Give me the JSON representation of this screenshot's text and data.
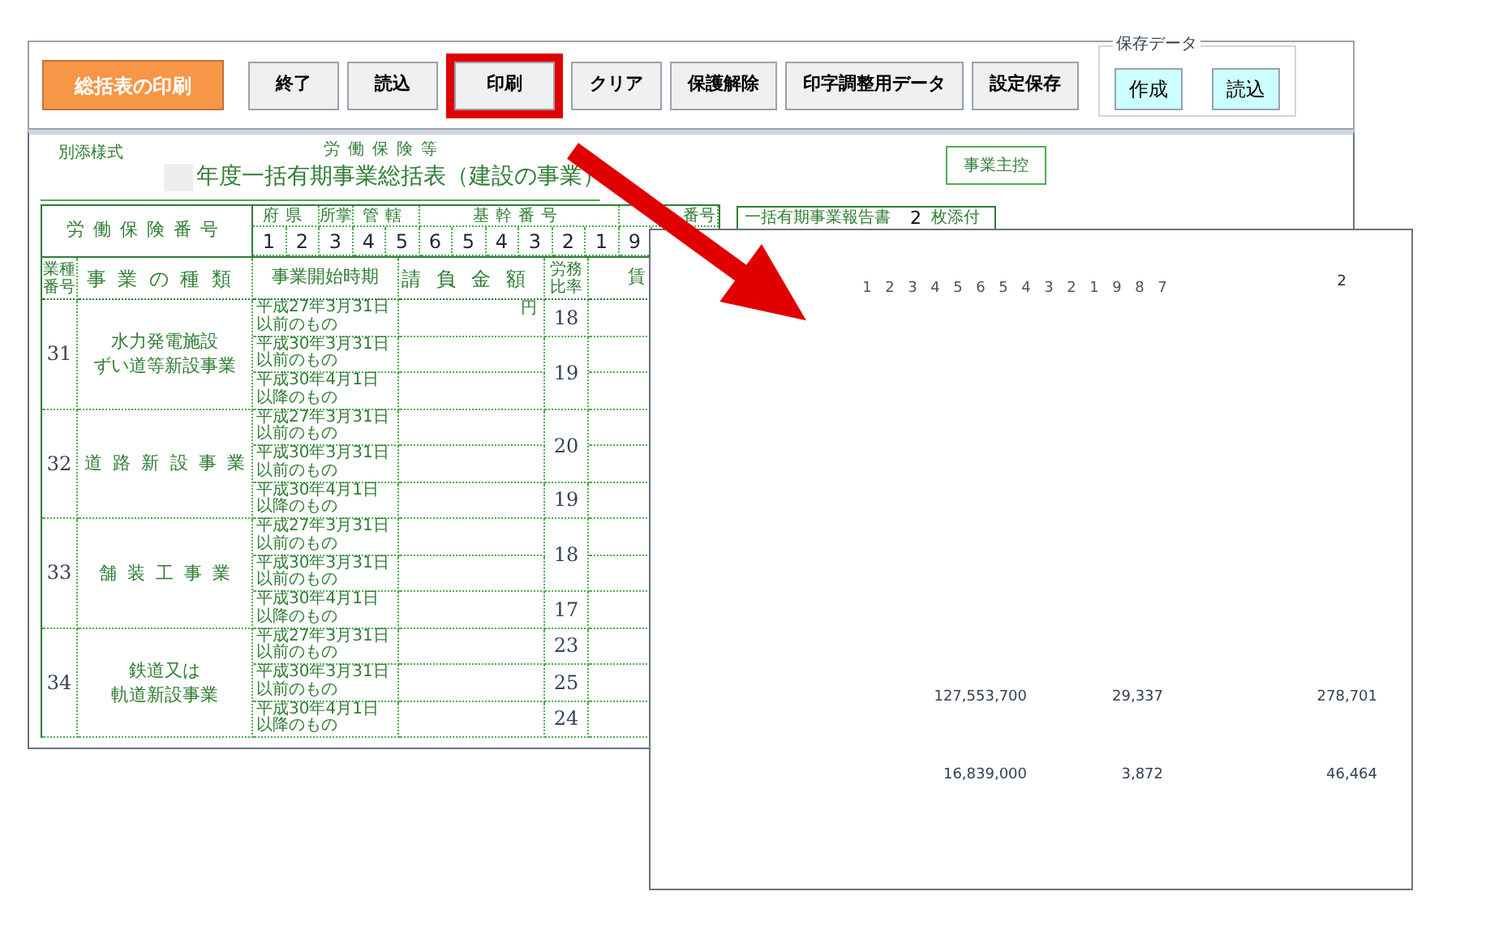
{
  "toolbar": {
    "print_summary_button": "総括表の印刷",
    "buttons": [
      {
        "label": "終了",
        "highlighted": false
      },
      {
        "label": "読込",
        "highlighted": false
      },
      {
        "label": "印刷",
        "highlighted": true
      },
      {
        "label": "クリア",
        "highlighted": false
      },
      {
        "label": "保護解除",
        "highlighted": false
      },
      {
        "label": "印字調整用データ",
        "highlighted": false
      },
      {
        "label": "設定保存",
        "highlighted": false
      }
    ],
    "save_data": {
      "title": "保存データ",
      "buttons": [
        "作成",
        "読込"
      ]
    }
  },
  "sheet": {
    "form_label": "別添様式",
    "heading": "労働保険等",
    "title": "年度一括有期事業総括表（建設の事業）",
    "copy_button": "事業主控",
    "report": {
      "label": "一括有期事業報告書",
      "count": "2",
      "suffix": "枚添付"
    },
    "insurance_number": {
      "label": "労働保険番号",
      "groups": [
        "府県",
        "所掌",
        "管轄",
        "基幹番号",
        "番号"
      ],
      "digits": [
        "1",
        "2",
        "3",
        "4",
        "5",
        "6",
        "5",
        "4",
        "3",
        "2",
        "1",
        "9"
      ]
    },
    "table": {
      "columns": [
        "業種番号",
        "事業の種類",
        "事業開始時期",
        "請負金額",
        "労務比率",
        "賃"
      ],
      "amount_unit": "円",
      "groups": [
        {
          "number": "31",
          "type": [
            "水力発電施設",
            "ずい道等新設事業"
          ],
          "periods": [
            {
              "date": "平成27年3月31日",
              "note": "以前のもの"
            },
            {
              "date": "平成30年3月31日",
              "note": "以前のもの"
            },
            {
              "date": "平成30年4月1日",
              "note": "以降のもの"
            }
          ],
          "rates": [
            {
              "value": "18",
              "kind": "single"
            },
            {
              "value": "19",
              "kind": "double"
            }
          ]
        },
        {
          "number": "32",
          "type": [
            "道路新設事業"
          ],
          "periods": [
            {
              "date": "平成27年3月31日",
              "note": "以前のもの"
            },
            {
              "date": "平成30年3月31日",
              "note": "以前のもの"
            },
            {
              "date": "平成30年4月1日",
              "note": "以降のもの"
            }
          ],
          "rates": [
            {
              "value": "20",
              "kind": "double"
            },
            {
              "value": "19",
              "kind": "single"
            }
          ]
        },
        {
          "number": "33",
          "type": [
            "舗装工事業"
          ],
          "periods": [
            {
              "date": "平成27年3月31日",
              "note": "以前のもの"
            },
            {
              "date": "平成30年3月31日",
              "note": "以前のもの"
            },
            {
              "date": "平成30年4月1日",
              "note": "以降のもの"
            }
          ],
          "rates": [
            {
              "value": "18",
              "kind": "double"
            },
            {
              "value": "17",
              "kind": "single"
            }
          ]
        },
        {
          "number": "34",
          "type": [
            "鉄道又は",
            "軌道新設事業"
          ],
          "periods": [
            {
              "date": "平成27年3月31日",
              "note": "以前のもの"
            },
            {
              "date": "平成30年3月31日",
              "note": "以前のもの"
            },
            {
              "date": "平成30年4月1日",
              "note": "以降のもの"
            }
          ],
          "rates": [
            {
              "value": "23",
              "kind": "single"
            },
            {
              "value": "25",
              "kind": "single"
            },
            {
              "value": "24",
              "kind": "single"
            }
          ]
        }
      ]
    }
  },
  "preview": {
    "digits": [
      "1",
      "2",
      "3",
      "4",
      "5",
      "6",
      "5",
      "4",
      "3",
      "2",
      "1",
      "9",
      "8",
      "7"
    ],
    "count": "2",
    "rows": [
      [
        "127,553,700",
        "29,337",
        "278,701"
      ],
      [
        "16,839,000",
        "3,872",
        "46,464"
      ]
    ]
  }
}
